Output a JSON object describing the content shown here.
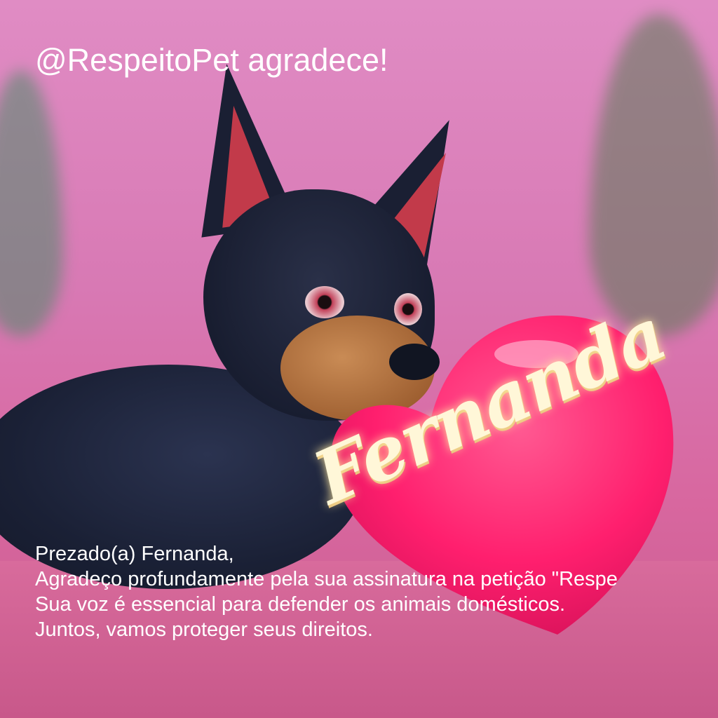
{
  "title": "@RespeitoPet agradece!",
  "heart_text": "Fernanda",
  "message": {
    "lines": [
      "Prezado(a) Fernanda,",
      "Agradeço profundamente pela sua assinatura na petição \"Respe",
      "Sua voz é essencial para defender os animais domésticos.",
      "Juntos, vamos proteger seus direitos."
    ]
  },
  "colors": {
    "background": "#d879b4",
    "heart": "#ff1f6e",
    "text": "#ffffff"
  }
}
